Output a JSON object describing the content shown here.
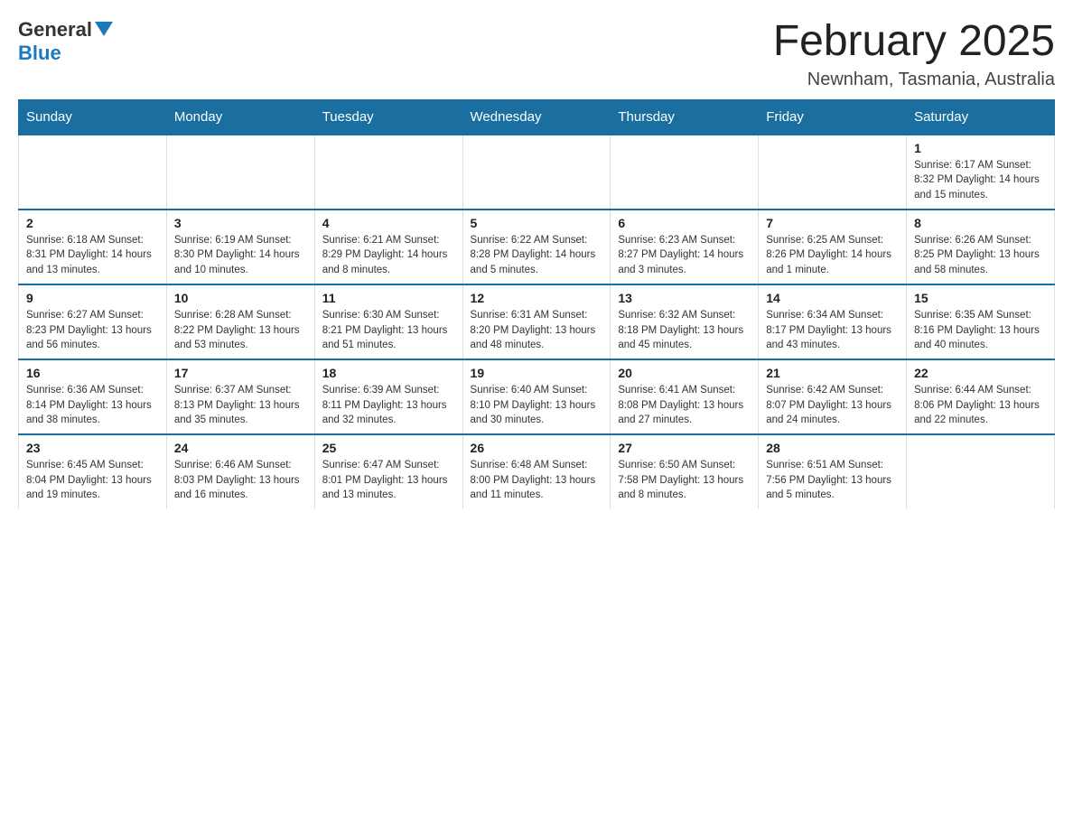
{
  "logo": {
    "general": "General",
    "blue": "Blue"
  },
  "title": "February 2025",
  "subtitle": "Newnham, Tasmania, Australia",
  "days_of_week": [
    "Sunday",
    "Monday",
    "Tuesday",
    "Wednesday",
    "Thursday",
    "Friday",
    "Saturday"
  ],
  "weeks": [
    [
      {
        "day": "",
        "info": ""
      },
      {
        "day": "",
        "info": ""
      },
      {
        "day": "",
        "info": ""
      },
      {
        "day": "",
        "info": ""
      },
      {
        "day": "",
        "info": ""
      },
      {
        "day": "",
        "info": ""
      },
      {
        "day": "1",
        "info": "Sunrise: 6:17 AM\nSunset: 8:32 PM\nDaylight: 14 hours and 15 minutes."
      }
    ],
    [
      {
        "day": "2",
        "info": "Sunrise: 6:18 AM\nSunset: 8:31 PM\nDaylight: 14 hours and 13 minutes."
      },
      {
        "day": "3",
        "info": "Sunrise: 6:19 AM\nSunset: 8:30 PM\nDaylight: 14 hours and 10 minutes."
      },
      {
        "day": "4",
        "info": "Sunrise: 6:21 AM\nSunset: 8:29 PM\nDaylight: 14 hours and 8 minutes."
      },
      {
        "day": "5",
        "info": "Sunrise: 6:22 AM\nSunset: 8:28 PM\nDaylight: 14 hours and 5 minutes."
      },
      {
        "day": "6",
        "info": "Sunrise: 6:23 AM\nSunset: 8:27 PM\nDaylight: 14 hours and 3 minutes."
      },
      {
        "day": "7",
        "info": "Sunrise: 6:25 AM\nSunset: 8:26 PM\nDaylight: 14 hours and 1 minute."
      },
      {
        "day": "8",
        "info": "Sunrise: 6:26 AM\nSunset: 8:25 PM\nDaylight: 13 hours and 58 minutes."
      }
    ],
    [
      {
        "day": "9",
        "info": "Sunrise: 6:27 AM\nSunset: 8:23 PM\nDaylight: 13 hours and 56 minutes."
      },
      {
        "day": "10",
        "info": "Sunrise: 6:28 AM\nSunset: 8:22 PM\nDaylight: 13 hours and 53 minutes."
      },
      {
        "day": "11",
        "info": "Sunrise: 6:30 AM\nSunset: 8:21 PM\nDaylight: 13 hours and 51 minutes."
      },
      {
        "day": "12",
        "info": "Sunrise: 6:31 AM\nSunset: 8:20 PM\nDaylight: 13 hours and 48 minutes."
      },
      {
        "day": "13",
        "info": "Sunrise: 6:32 AM\nSunset: 8:18 PM\nDaylight: 13 hours and 45 minutes."
      },
      {
        "day": "14",
        "info": "Sunrise: 6:34 AM\nSunset: 8:17 PM\nDaylight: 13 hours and 43 minutes."
      },
      {
        "day": "15",
        "info": "Sunrise: 6:35 AM\nSunset: 8:16 PM\nDaylight: 13 hours and 40 minutes."
      }
    ],
    [
      {
        "day": "16",
        "info": "Sunrise: 6:36 AM\nSunset: 8:14 PM\nDaylight: 13 hours and 38 minutes."
      },
      {
        "day": "17",
        "info": "Sunrise: 6:37 AM\nSunset: 8:13 PM\nDaylight: 13 hours and 35 minutes."
      },
      {
        "day": "18",
        "info": "Sunrise: 6:39 AM\nSunset: 8:11 PM\nDaylight: 13 hours and 32 minutes."
      },
      {
        "day": "19",
        "info": "Sunrise: 6:40 AM\nSunset: 8:10 PM\nDaylight: 13 hours and 30 minutes."
      },
      {
        "day": "20",
        "info": "Sunrise: 6:41 AM\nSunset: 8:08 PM\nDaylight: 13 hours and 27 minutes."
      },
      {
        "day": "21",
        "info": "Sunrise: 6:42 AM\nSunset: 8:07 PM\nDaylight: 13 hours and 24 minutes."
      },
      {
        "day": "22",
        "info": "Sunrise: 6:44 AM\nSunset: 8:06 PM\nDaylight: 13 hours and 22 minutes."
      }
    ],
    [
      {
        "day": "23",
        "info": "Sunrise: 6:45 AM\nSunset: 8:04 PM\nDaylight: 13 hours and 19 minutes."
      },
      {
        "day": "24",
        "info": "Sunrise: 6:46 AM\nSunset: 8:03 PM\nDaylight: 13 hours and 16 minutes."
      },
      {
        "day": "25",
        "info": "Sunrise: 6:47 AM\nSunset: 8:01 PM\nDaylight: 13 hours and 13 minutes."
      },
      {
        "day": "26",
        "info": "Sunrise: 6:48 AM\nSunset: 8:00 PM\nDaylight: 13 hours and 11 minutes."
      },
      {
        "day": "27",
        "info": "Sunrise: 6:50 AM\nSunset: 7:58 PM\nDaylight: 13 hours and 8 minutes."
      },
      {
        "day": "28",
        "info": "Sunrise: 6:51 AM\nSunset: 7:56 PM\nDaylight: 13 hours and 5 minutes."
      },
      {
        "day": "",
        "info": ""
      }
    ]
  ]
}
